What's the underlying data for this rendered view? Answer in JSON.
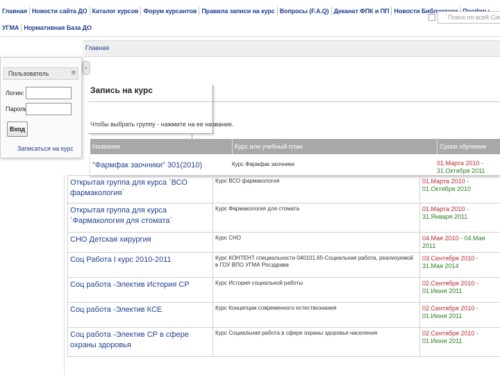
{
  "nav": {
    "row1": [
      "Главная",
      "Новости сайта ДО",
      "Каталог курсов",
      "Форум курсантов",
      "Правила записи на курс",
      "Вопросы (F.A.Q)",
      "Деканат ФПК и ПП",
      "Новости Библиотеки",
      "Профмы"
    ],
    "row2": [
      "УГМА",
      "Нормативная База ДО"
    ],
    "search_placeholder": "Поиск по всей Сист"
  },
  "breadcrumb": "Главная",
  "login": {
    "header": "Пользователь",
    "menu_glyph": "≡",
    "login_label": "Логин:",
    "password_label": "Пароль:",
    "enter_button": "Вход",
    "signup_link": "Записаться на курс"
  },
  "page": {
    "title": "Запись на курс",
    "hint": "Чтобы выбрать группу - нажмите на ее название."
  },
  "table": {
    "headers": [
      "Название",
      "Курс или учебный план",
      "Сроки обучения"
    ],
    "first_row": {
      "name": "\"Фармфак заочники\" 301(2010)",
      "plan": "Курс Фармфак заочники",
      "start": "01.Марта 2010 -",
      "end": "31.Октября 2011"
    },
    "rows": [
      {
        "name": "Открытая группа для курса `ВСО фармакология`",
        "plan": "Курс ВСО фармакология",
        "start": "01.Марта 2010 -",
        "end": "01.Октября 2010"
      },
      {
        "name": "Открытая группа для курса `Фармакология для стомата`",
        "plan": "Курс Фармакология для стомата",
        "start": "01.Марта 2010 -",
        "end": "31.Января 2011"
      },
      {
        "name": "СНО Детская хирургия",
        "plan": "Курс СНО",
        "start": "04.Мая 2010",
        "end": "- 04.Мая 2011"
      },
      {
        "name": "Соц Работа I курс 2010-2011",
        "plan": "Курс КОНТЕНТ специальности 040101.65-Социальная работа, реализуемой в ГОУ ВПО УГМА Росздрава",
        "start": "03.Сентября 2010 -",
        "end": "31.Мая 2014"
      },
      {
        "name": "Соц работа -Электив История СР",
        "plan": "Курс История социальной работы",
        "start": "02.Сентября 2010 -",
        "end": "01.Июня 2011"
      },
      {
        "name": "Соц работа -Электив КСЕ",
        "plan": "Курс Концепции современного естествознания",
        "start": "02.Сентября 2010 -",
        "end": "01.Июня 2011"
      },
      {
        "name": "Соц работа -Электив СР в сфере охраны здоровья",
        "plan": "Курс Социальная работа в сфере охраны здоровья населения",
        "start": "02.Сентября 2010 -",
        "end": "01.Июня 2011"
      }
    ]
  }
}
